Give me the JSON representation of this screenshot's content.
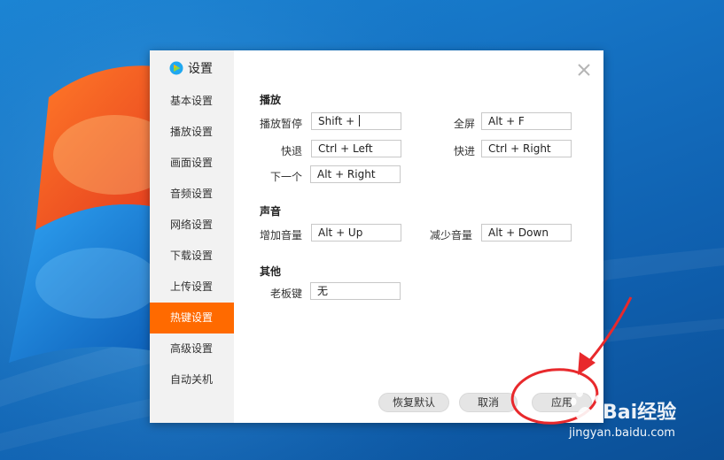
{
  "dialog": {
    "title": "设置",
    "close_icon": "close-icon",
    "sidebar": {
      "items": [
        {
          "label": "基本设置",
          "active": false
        },
        {
          "label": "播放设置",
          "active": false
        },
        {
          "label": "画面设置",
          "active": false
        },
        {
          "label": "音频设置",
          "active": false
        },
        {
          "label": "网络设置",
          "active": false
        },
        {
          "label": "下载设置",
          "active": false
        },
        {
          "label": "上传设置",
          "active": false
        },
        {
          "label": "热键设置",
          "active": true
        },
        {
          "label": "高级设置",
          "active": false
        },
        {
          "label": "自动关机",
          "active": false
        }
      ]
    },
    "sections": {
      "playback": {
        "title": "播放",
        "pause_label": "播放暂停",
        "pause_value": "Shift + ",
        "fullscreen_label": "全屏",
        "fullscreen_value": "Alt + F",
        "rewind_label": "快退",
        "rewind_value": "Ctrl + Left",
        "forward_label": "快进",
        "forward_value": "Ctrl + Right",
        "next_label": "下一个",
        "next_value": "Alt + Right"
      },
      "sound": {
        "title": "声音",
        "vol_up_label": "增加音量",
        "vol_up_value": "Alt + Up",
        "vol_down_label": "减少音量",
        "vol_down_value": "Alt + Down"
      },
      "other": {
        "title": "其他",
        "boss_label": "老板键",
        "boss_value": "无"
      }
    },
    "buttons": {
      "restore": "恢复默认",
      "cancel": "取消",
      "apply": "应用"
    }
  },
  "watermark": {
    "brand": "Bai经验",
    "url": "jingyan.baidu.com"
  },
  "colors": {
    "accent": "#ff6a00",
    "annotation": "#e8292c"
  }
}
